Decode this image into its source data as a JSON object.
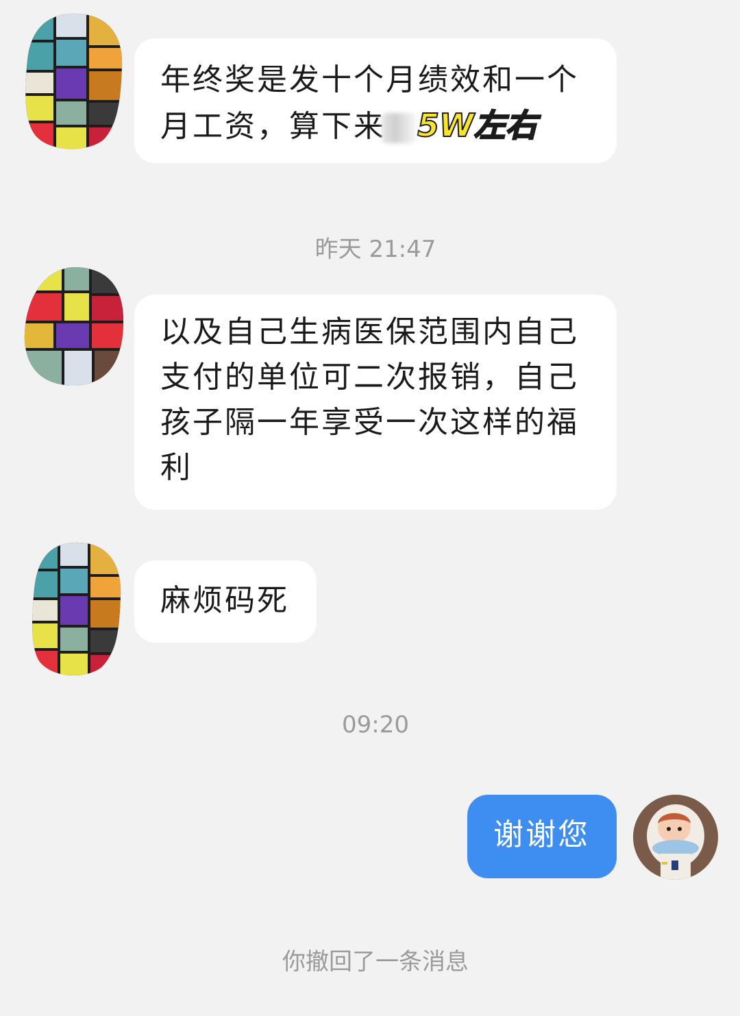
{
  "messages": [
    {
      "text_before": "年终奖是发十个月绩效和一个月工资，算下来",
      "highlight": "5W左右"
    },
    {
      "timestamp": "昨天 21:47",
      "text": "以及自己生病医保范围内自己支付的单位可二次报销，自己孩子隔一年享受一次这样的福利"
    },
    {
      "text": "麻烦码死"
    },
    {
      "timestamp": "09:20",
      "text": "谢谢您"
    }
  ],
  "system_notice": "你撤回了一条消息",
  "colors": {
    "background": "#f2f2f2",
    "incoming_bubble": "#ffffff",
    "outgoing_bubble": "#3d8ef0",
    "timestamp_text": "#9a9a9a",
    "highlight_fill": "#fbe52a"
  }
}
